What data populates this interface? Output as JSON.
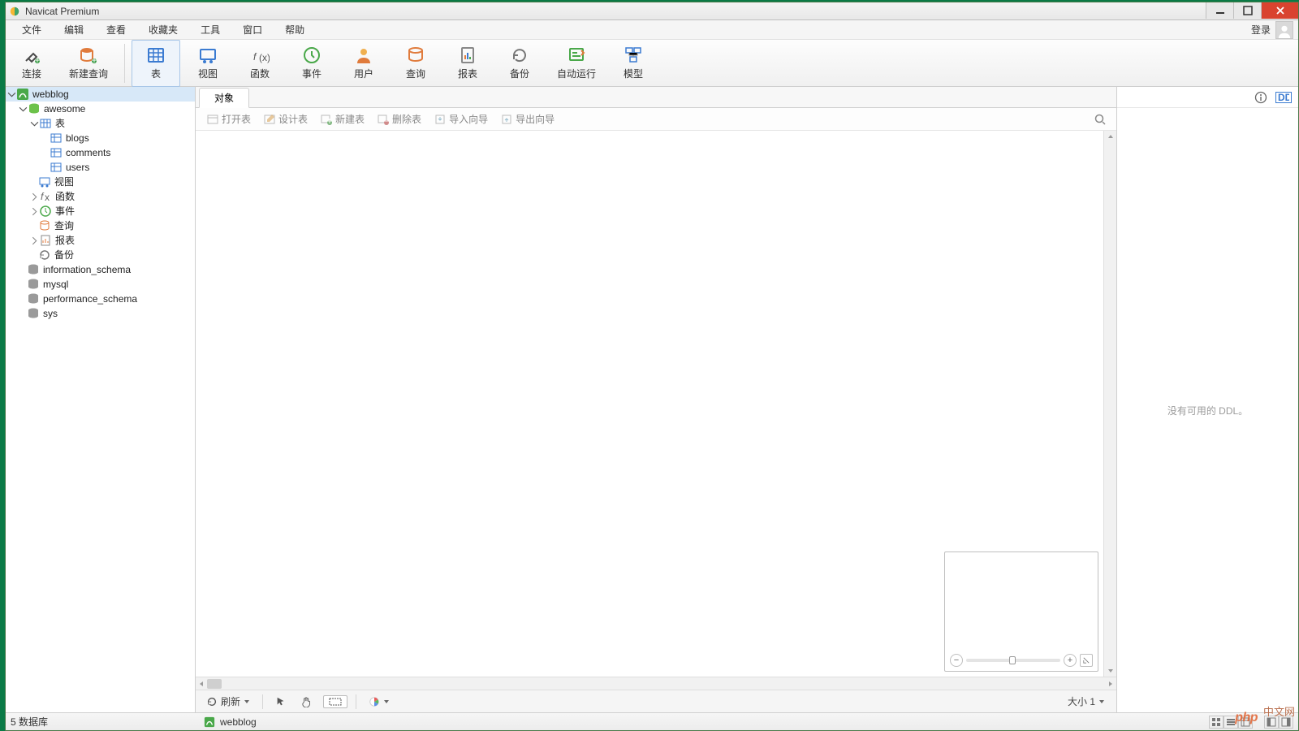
{
  "app_title": "Navicat Premium",
  "menubar": {
    "items": [
      "文件",
      "编辑",
      "查看",
      "收藏夹",
      "工具",
      "窗口",
      "帮助"
    ],
    "login_label": "登录"
  },
  "toolbar": {
    "items": [
      {
        "id": "connection",
        "label": "连接"
      },
      {
        "id": "new-query",
        "label": "新建查询"
      },
      {
        "id": "table",
        "label": "表",
        "active": true
      },
      {
        "id": "view",
        "label": "视图"
      },
      {
        "id": "function",
        "label": "函数"
      },
      {
        "id": "event",
        "label": "事件"
      },
      {
        "id": "user",
        "label": "用户"
      },
      {
        "id": "query",
        "label": "查询"
      },
      {
        "id": "report",
        "label": "报表"
      },
      {
        "id": "backup",
        "label": "备份"
      },
      {
        "id": "automation",
        "label": "自动运行"
      },
      {
        "id": "model",
        "label": "模型"
      }
    ]
  },
  "tree": {
    "connection": "webblog",
    "database_open": "awesome",
    "table_group": "表",
    "tables": [
      "blogs",
      "comments",
      "users"
    ],
    "other_groups": [
      {
        "id": "views",
        "label": "视图"
      },
      {
        "id": "functions",
        "label": "函数"
      },
      {
        "id": "events",
        "label": "事件"
      },
      {
        "id": "queries",
        "label": "查询"
      },
      {
        "id": "reports",
        "label": "报表"
      },
      {
        "id": "backups",
        "label": "备份"
      }
    ],
    "other_databases": [
      "information_schema",
      "mysql",
      "performance_schema",
      "sys"
    ]
  },
  "tabs": {
    "objects_label": "对象"
  },
  "sub_toolbar": {
    "open_table": "打开表",
    "design_table": "设计表",
    "new_table": "新建表",
    "delete_table": "删除表",
    "import_wizard": "导入向导",
    "export_wizard": "导出向导"
  },
  "bottom_toolbar": {
    "refresh": "刷新",
    "size_label": "大小 1"
  },
  "right_panel": {
    "no_ddl": "没有可用的 DDL。"
  },
  "statusbar": {
    "db_count": "5 数据库",
    "connection": "webblog"
  },
  "watermark": {
    "php": "php",
    "cn": "中文网"
  }
}
